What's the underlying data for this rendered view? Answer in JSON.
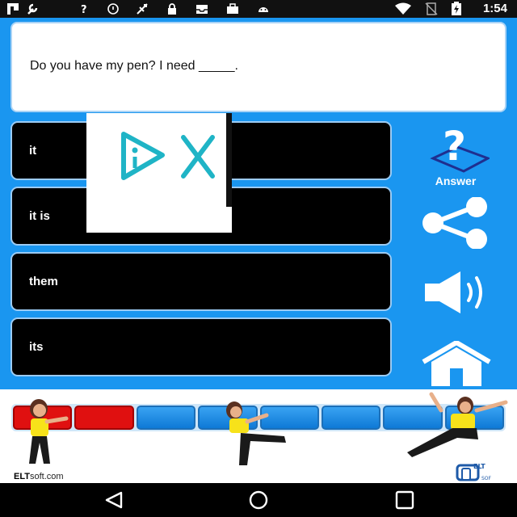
{
  "status_bar": {
    "time": "1:54",
    "icons": [
      "flipboard-icon",
      "wrench-icon",
      "help-icon",
      "alarm-icon",
      "no-signal-icon",
      "lock-icon",
      "inbox-icon",
      "briefcase-icon",
      "android-icon",
      "wifi-icon",
      "no-sim-icon",
      "battery-charging-icon"
    ]
  },
  "question": {
    "text": "Do you have my pen? I need _____."
  },
  "options": [
    {
      "label": "it"
    },
    {
      "label": "it is"
    },
    {
      "label": "them"
    },
    {
      "label": "its"
    }
  ],
  "sidebar": {
    "answer_label": "Answer",
    "buttons": [
      "answer-icon",
      "share-icon",
      "speaker-icon",
      "home-icon"
    ]
  },
  "ad": {
    "icons": [
      "ad-choices-icon",
      "close-icon"
    ]
  },
  "progress": {
    "completed": 2,
    "total": 8
  },
  "footer": {
    "brand_bold": "ELT",
    "brand_rest": "soft.com",
    "logo_text": "ELT SOFT"
  },
  "nav": {
    "buttons": [
      "back-icon",
      "home-circle-icon",
      "recents-icon"
    ]
  },
  "colors": {
    "app_bg": "#1a96f0",
    "option_bg": "#000000",
    "progress_done": "#e01010",
    "progress_todo": "#0e79d6"
  }
}
